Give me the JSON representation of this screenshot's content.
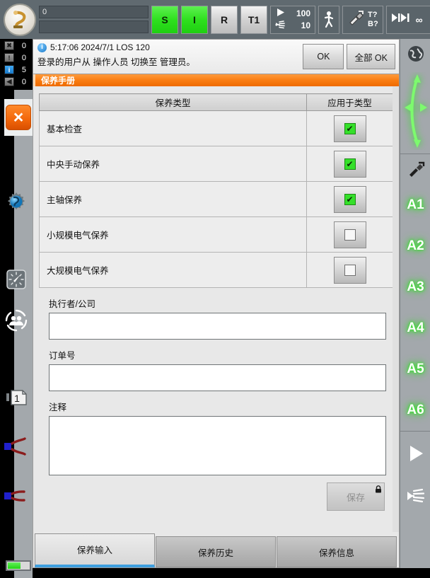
{
  "topbar": {
    "logo_icon": "robot-arm-icon",
    "status_field_1": "0",
    "status_field_2": "",
    "buttons": [
      {
        "label": "S",
        "state": "green"
      },
      {
        "label": "I",
        "state": "green"
      },
      {
        "label": "R",
        "state": "gray"
      },
      {
        "label": "T1",
        "state": "gray"
      }
    ],
    "override_program": "100",
    "override_jog": "10",
    "play_icon": "play-triangle-icon",
    "hand_icon": "hand-jog-icon",
    "walk_icon": "walking-person-icon",
    "tool_icon": "tool-icon",
    "tool_label_top": "T?",
    "tool_label_bottom": "B?",
    "step_icon": "step-forward-icon",
    "infinity_label": "∞"
  },
  "left_rail": {
    "message_counts": [
      {
        "icon": "error-icon",
        "count": "0"
      },
      {
        "icon": "warning-icon",
        "count": "0"
      },
      {
        "icon": "info-icon",
        "count": "5"
      },
      {
        "icon": "wait-icon",
        "count": "0"
      }
    ],
    "close_button_label": "×",
    "close_button_name": "close-message-button",
    "icons": [
      "settings-gear-icon",
      "clock-pointer-icon",
      "user-group-icon",
      "program-1-icon",
      "gripper-open-icon",
      "gripper-closed-icon"
    ],
    "battery_icon": "battery-indicator"
  },
  "right_rail": {
    "globe_icon": "world-coordinate-icon",
    "motion_icon": "axis-motion-indicator-icon",
    "tool_icon": "tool-coordinate-icon",
    "axes": [
      "A1",
      "A2",
      "A3",
      "A4",
      "A5",
      "A6"
    ],
    "play_icon": "play-triangle-icon",
    "hand_icon": "hand-jog-icon"
  },
  "message": {
    "icon": "info-icon",
    "timestamp": "5:17:06 2024/7/1  LOS 120",
    "text": "登录的用户从 操作人员 切换至 管理员。",
    "ok_label": "OK",
    "ok_all_label": "全部 OK"
  },
  "panel": {
    "title": "保养手册",
    "accent_color": "#f97d12"
  },
  "table": {
    "headers": [
      "保养类型",
      "应用于类型"
    ],
    "rows": [
      {
        "name": "基本检查",
        "checked": true
      },
      {
        "name": "中央手动保养",
        "checked": true
      },
      {
        "name": "主轴保养",
        "checked": true
      },
      {
        "name": "小规模电气保养",
        "checked": false
      },
      {
        "name": "大规模电气保养",
        "checked": false
      }
    ],
    "check_glyph": "✔"
  },
  "form": {
    "executor_label": "执行者/公司",
    "executor_value": "",
    "order_label": "订单号",
    "order_value": "",
    "note_label": "注释",
    "note_value": "",
    "save_label": "保存",
    "save_locked_icon": "lock-icon"
  },
  "tabs": [
    {
      "label": "保养输入",
      "active": true
    },
    {
      "label": "保养历史",
      "active": false
    },
    {
      "label": "保养信息",
      "active": false
    }
  ]
}
